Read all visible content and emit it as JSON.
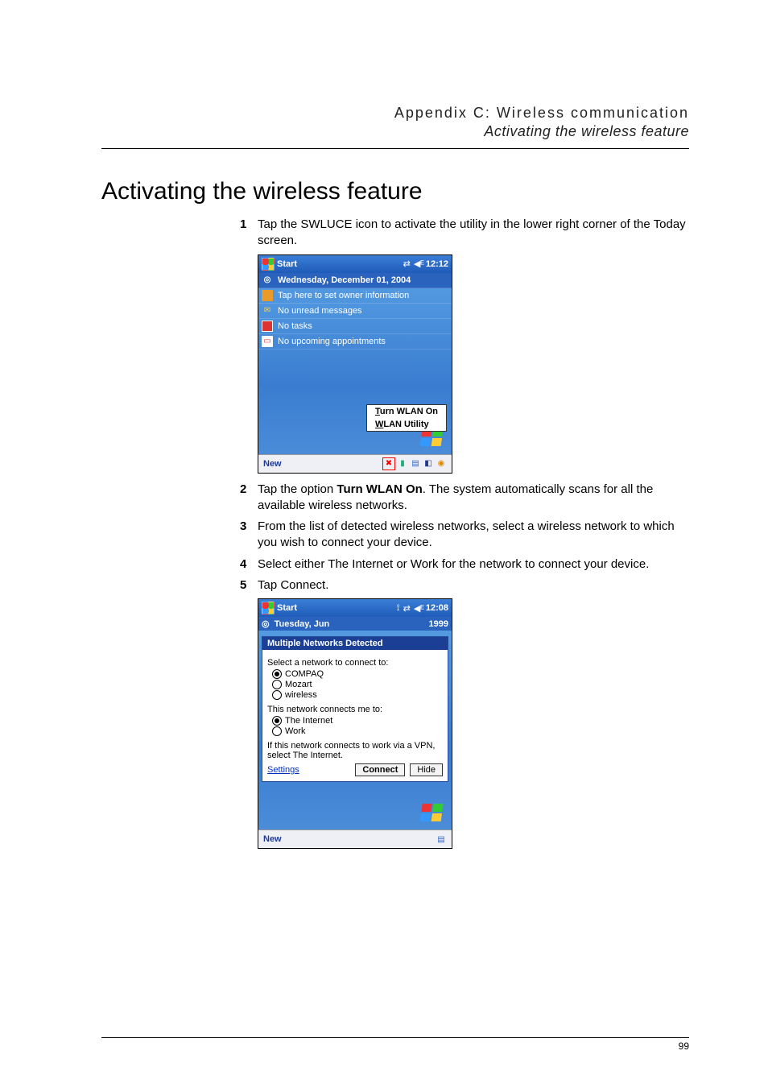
{
  "header": {
    "appendix": "Appendix C: Wireless communication",
    "subtitle": "Activating the wireless feature"
  },
  "title": "Activating the wireless feature",
  "steps": {
    "s1": "Tap the SWLUCE icon to activate the utility in the lower right corner of the Today screen.",
    "s2a": "Tap the option ",
    "s2b": "Turn WLAN On",
    "s2c": ". The system automatically scans for all the available wireless networks.",
    "s3": "From the list of detected wireless networks, select a wireless network to which you wish to connect your device.",
    "s4": "Select either The Internet or Work for the network to connect your device.",
    "s5": "Tap Connect."
  },
  "fig1": {
    "start": "Start",
    "time": "12:12",
    "date": "Wednesday, December 01, 2004",
    "owner": "Tap here to set owner information",
    "mail": "No unread messages",
    "tasks": "No tasks",
    "cal": "No upcoming appointments",
    "menu1a": "T",
    "menu1b": "urn WLAN On",
    "menu2a": "W",
    "menu2b": "LAN Utility",
    "new": "New"
  },
  "fig2": {
    "start": "Start",
    "time": "12:08",
    "peekdate": "Tuesday, Jun",
    "peekyear": "1999",
    "dlg_title": "Multiple Networks Detected",
    "prompt1": "Select a network to connect to:",
    "net1": "COMPAQ",
    "net2": "Mozart",
    "net3": "wireless",
    "prompt2": "This network connects me to:",
    "dst1": "The Internet",
    "dst2": "Work",
    "vpn": "If this network connects to work via a VPN, select The Internet.",
    "settings": "Settings",
    "connect": "Connect",
    "hide": "Hide",
    "new": "New"
  },
  "page_number": "99"
}
